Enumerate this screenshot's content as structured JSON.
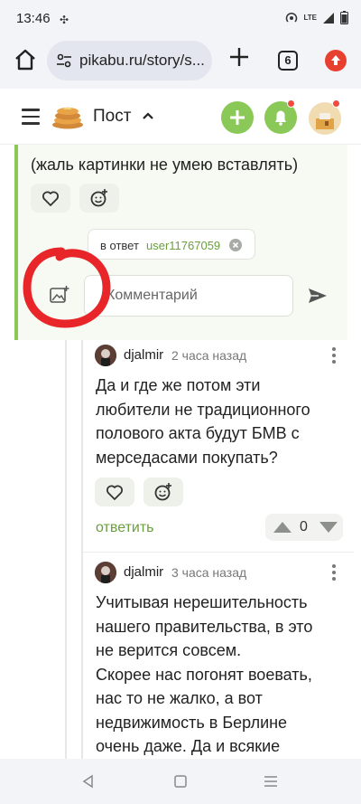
{
  "status_bar": {
    "time": "13:46",
    "network": "LTE"
  },
  "browser": {
    "url": "pikabu.ru/story/s...",
    "tab_count": "6"
  },
  "site": {
    "section": "Пост"
  },
  "previous_comment": {
    "text": "(жаль картинки не умею вставлять)"
  },
  "reply_form": {
    "reply_to_label": "в ответ",
    "reply_to_user": "user11767059",
    "input_placeholder": "Комментарий"
  },
  "comments": [
    {
      "author": "djalmir",
      "time": "2 часа назад",
      "text": "Да и где же потом эти любители не традиционного полового акта будут БМВ с мерседасами покупать?",
      "reply_label": "ответить",
      "score": "0"
    },
    {
      "author": "djalmir",
      "time": "3 часа назад",
      "text": "Учитывая нерешительность нашего правительства, в это не верится совсем.\nСкорее нас погонят воевать, нас то не жалко, а вот недвижимость в Берлине очень даже. Да и всякие мерцы с"
    }
  ],
  "colors": {
    "accent_green": "#8ac858",
    "link_green": "#6a9f3e",
    "notification_red": "#ef4b3f",
    "annotation_red": "#e8262a"
  }
}
